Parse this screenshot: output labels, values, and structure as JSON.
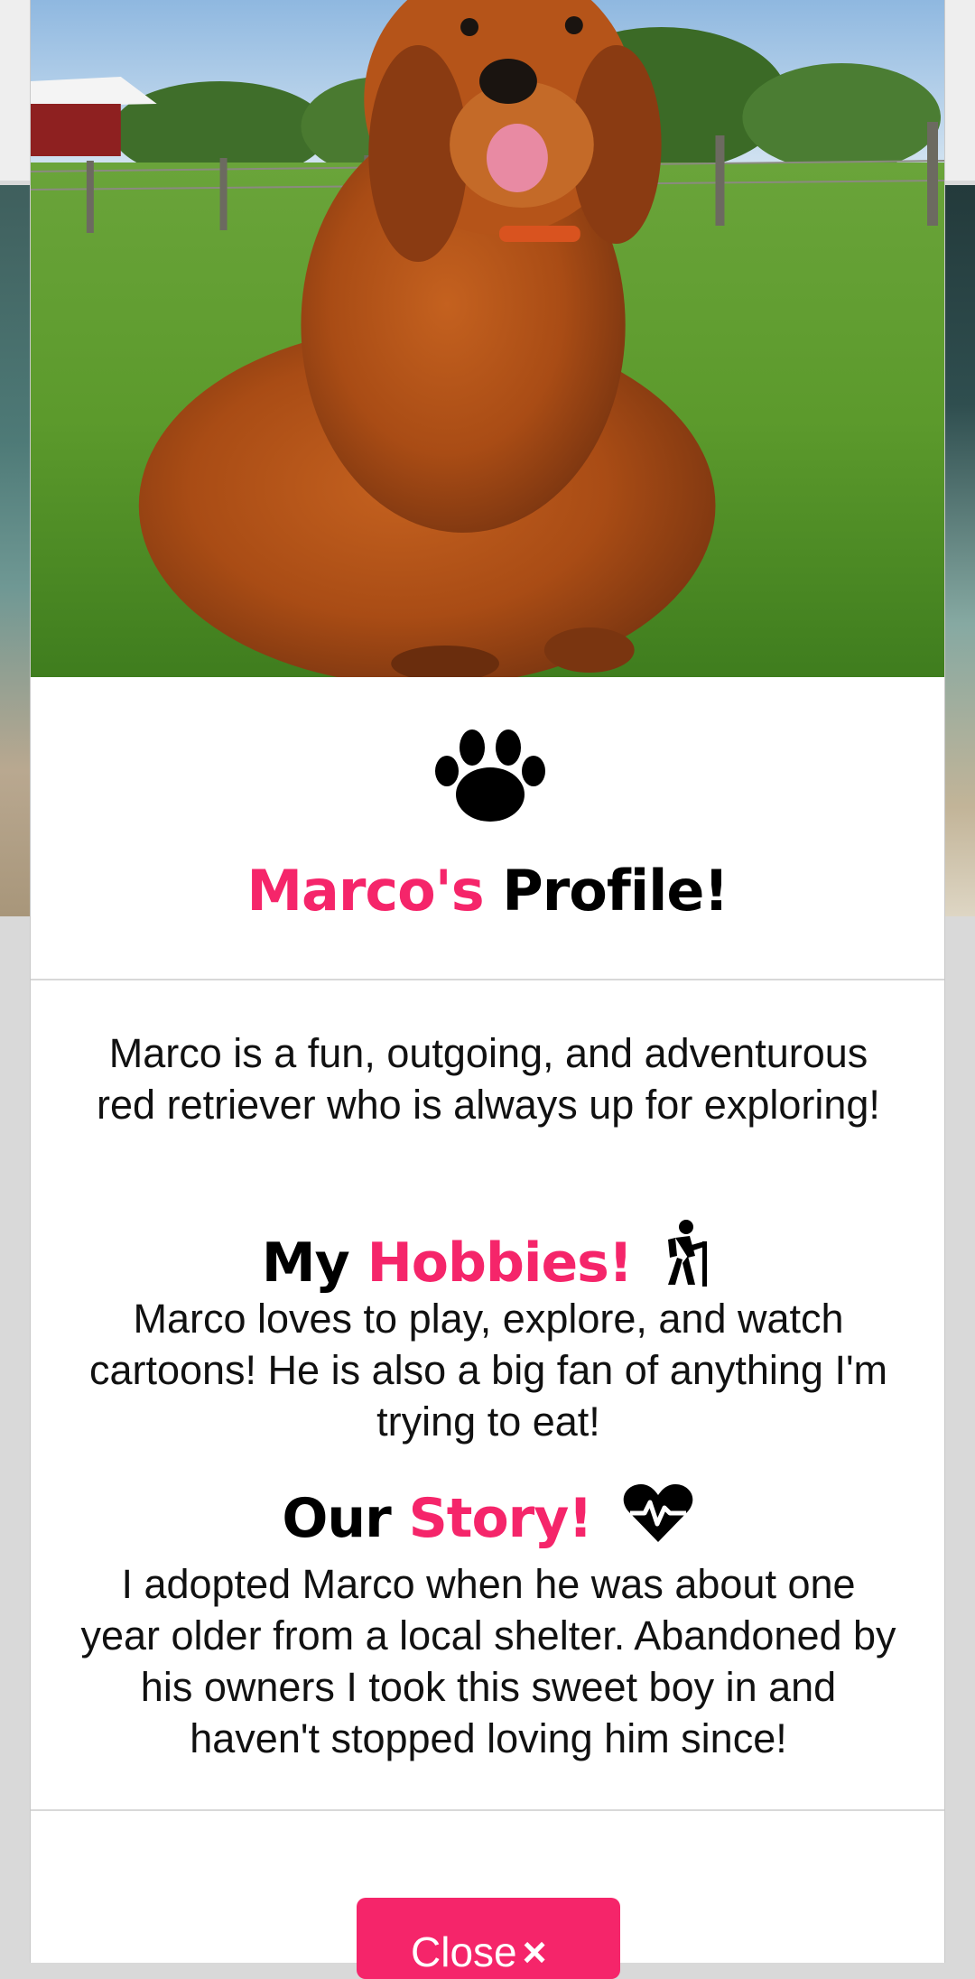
{
  "modal": {
    "title_name": "Marco's",
    "title_rest": "Profile!",
    "intro": "Marco is a fun, outgoing, and adventurous red retriever who is always up for exploring!",
    "hobbies_heading_a": "My",
    "hobbies_heading_b": "Hobbies!",
    "hobbies_text": "Marco loves to play, explore, and watch cartoons! He is also a big fan of anything I'm trying to eat!",
    "story_heading_a": "Our",
    "story_heading_b": "Story!",
    "story_text": "I adopted Marco when he was about one year older from a local shelter. Abandoned by his owners I took this sweet boy in and haven't stopped loving him since!",
    "close_label": "Close",
    "close_icon": "×"
  },
  "icons": {
    "paw": "paw-icon",
    "hiking": "hiking-icon",
    "heartbeat": "heartbeat-icon",
    "close": "close-icon"
  },
  "colors": {
    "accent": "#f5256a",
    "text": "#111111"
  }
}
